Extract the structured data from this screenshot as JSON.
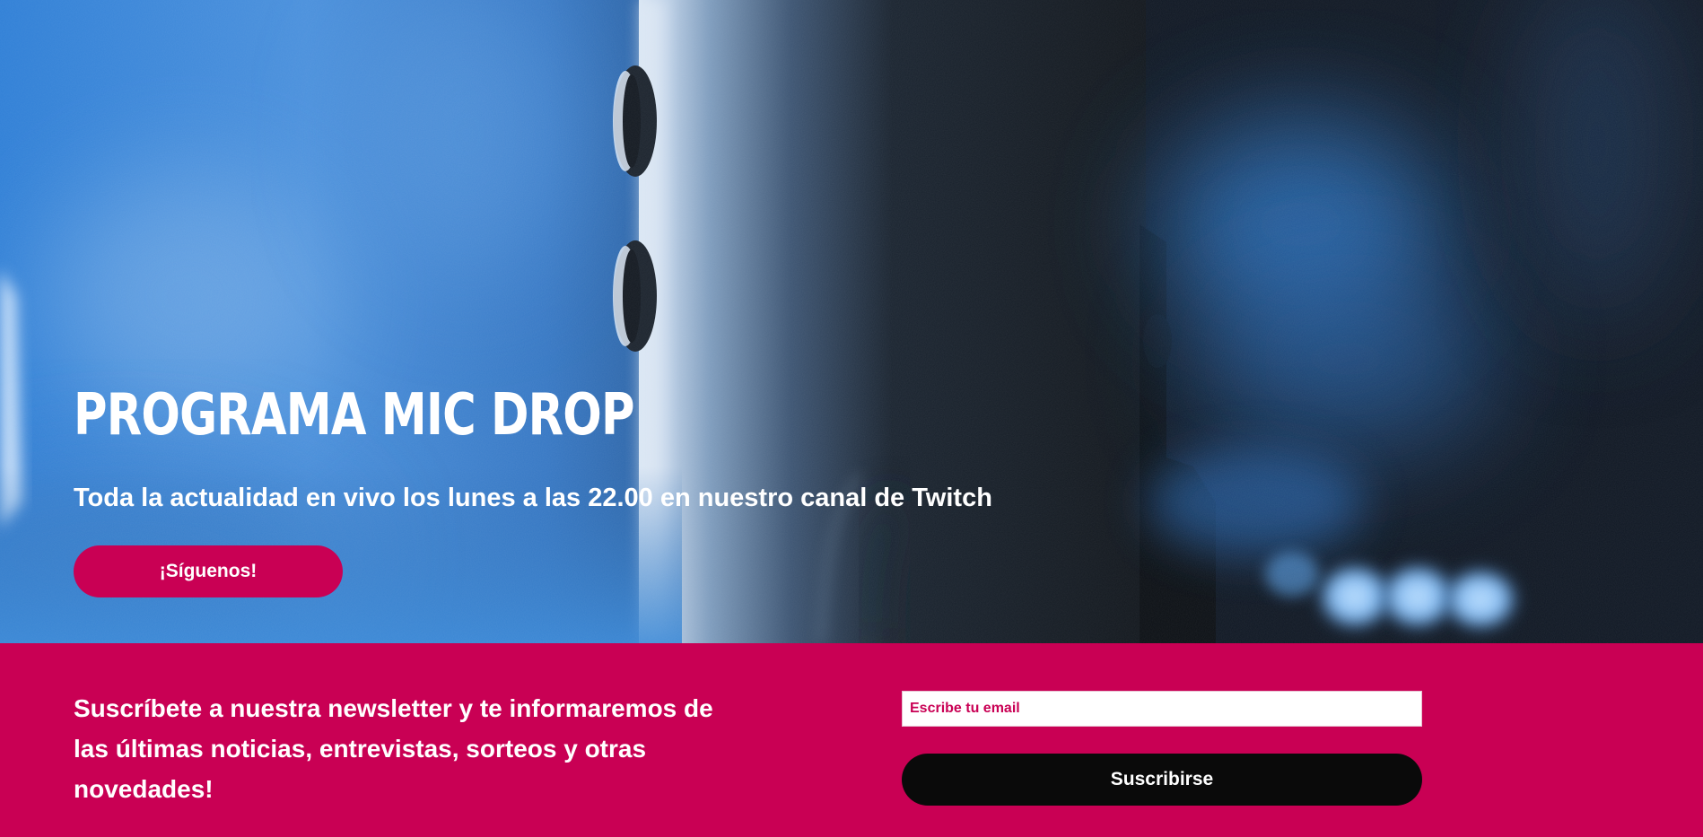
{
  "hero": {
    "image": "microphone-photo",
    "title": "PROGRAMA MIC DROP",
    "subtitle": "Toda la actualidad en vivo los lunes a las 22.00 en nuestro canal de Twitch",
    "cta_label": "¡Síguenos!"
  },
  "newsletter": {
    "text": "Suscríbete a nuestra newsletter y te informaremos de las últimas noticias, entrevistas, sorteos y otras novedades!",
    "email_placeholder": "Escribe tu email",
    "email_value": "",
    "subscribe_label": "Suscribirse"
  },
  "colors": {
    "accent": "#c90054",
    "button_dark": "#0a0a0a",
    "text_light": "#ffffff",
    "hero_dark": "#101519",
    "hero_blue": "#2f7fd6"
  }
}
